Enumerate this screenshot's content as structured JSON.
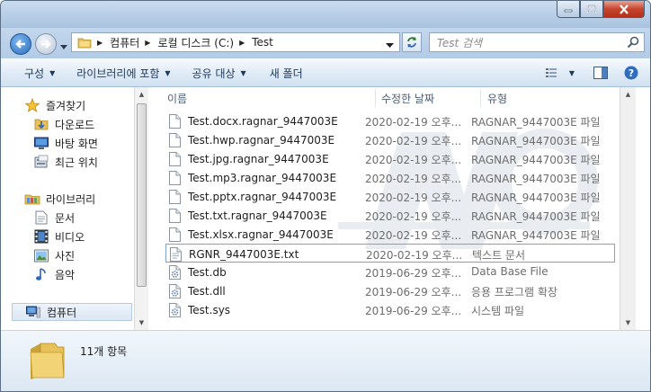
{
  "address": {
    "segments": [
      "컴퓨터",
      "로컬 디스크 (C:)",
      "Test"
    ]
  },
  "search": {
    "placeholder": "Test 검색"
  },
  "toolbar": {
    "organize": "구성",
    "include_library": "라이브러리에 포함",
    "share": "공유 대상",
    "new_folder": "새 폴더"
  },
  "nav": {
    "favorites": "즐겨찾기",
    "downloads": "다운로드",
    "desktop": "바탕 화면",
    "recent": "최근 위치",
    "libraries": "라이브러리",
    "documents": "문서",
    "videos": "비디오",
    "pictures": "사진",
    "music": "음악",
    "computer": "컴퓨터"
  },
  "columns": {
    "name": "이름",
    "date": "수정한 날짜",
    "type": "유형"
  },
  "files": [
    {
      "name": "Test.docx.ragnar_9447003E",
      "date": "2020-02-19 오후...",
      "type": "RAGNAR_9447003E 파일",
      "icon": "blank-file-icon"
    },
    {
      "name": "Test.hwp.ragnar_9447003E",
      "date": "2020-02-19 오후...",
      "type": "RAGNAR_9447003E 파일",
      "icon": "blank-file-icon"
    },
    {
      "name": "Test.jpg.ragnar_9447003E",
      "date": "2020-02-19 오후...",
      "type": "RAGNAR_9447003E 파일",
      "icon": "blank-file-icon"
    },
    {
      "name": "Test.mp3.ragnar_9447003E",
      "date": "2020-02-19 오후...",
      "type": "RAGNAR_9447003E 파일",
      "icon": "blank-file-icon"
    },
    {
      "name": "Test.pptx.ragnar_9447003E",
      "date": "2020-02-19 오후...",
      "type": "RAGNAR_9447003E 파일",
      "icon": "blank-file-icon"
    },
    {
      "name": "Test.txt.ragnar_9447003E",
      "date": "2020-02-19 오후...",
      "type": "RAGNAR_9447003E 파일",
      "icon": "blank-file-icon"
    },
    {
      "name": "Test.xlsx.ragnar_9447003E",
      "date": "2020-02-19 오후...",
      "type": "RAGNAR_9447003E 파일",
      "icon": "blank-file-icon"
    },
    {
      "name": "RGNR_9447003E.txt",
      "date": "2020-02-19 오후...",
      "type": "텍스트 문서",
      "icon": "text-file-icon"
    },
    {
      "name": "Test.db",
      "date": "2019-06-29 오후...",
      "type": "Data Base File",
      "icon": "gear-file-icon"
    },
    {
      "name": "Test.dll",
      "date": "2019-06-29 오후...",
      "type": "응용 프로그램 확장",
      "icon": "gear-file-icon"
    },
    {
      "name": "Test.sys",
      "date": "2019-06-29 오후...",
      "type": "시스템 파일",
      "icon": "gear-file-icon"
    }
  ],
  "status": {
    "count": "11개 항목"
  }
}
